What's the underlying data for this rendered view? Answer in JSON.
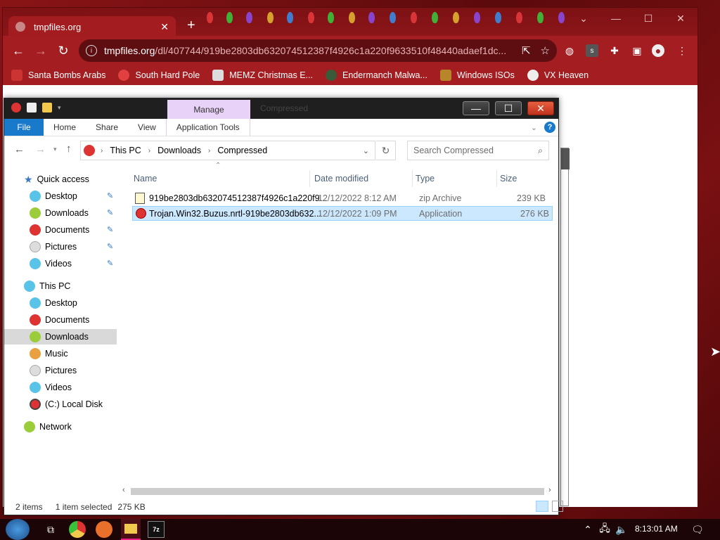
{
  "browser": {
    "tab_title": "tmpfiles.org",
    "url_host": "tmpfiles.org",
    "url_path": "/dl/407744/919be2803db632074512387f4926c1a220f9633510f48440adaef1dc...",
    "bookmarks": [
      {
        "label": "Santa Bombs Arabs",
        "icon": "santa-icon"
      },
      {
        "label": "South Hard Pole",
        "icon": "starburst-icon"
      },
      {
        "label": "MEMZ Christmas E...",
        "icon": "image-icon"
      },
      {
        "label": "Endermanch Malwa...",
        "icon": "ender-icon"
      },
      {
        "label": "Windows ISOs",
        "icon": "figure-icon"
      },
      {
        "label": "VX Heaven",
        "icon": "vx-icon"
      }
    ]
  },
  "explorer": {
    "manage_label": "Manage",
    "window_title": "Compressed",
    "ribbon_tabs": [
      "File",
      "Home",
      "Share",
      "View",
      "Application Tools"
    ],
    "breadcrumb": [
      "This PC",
      "Downloads",
      "Compressed"
    ],
    "search_placeholder": "Search Compressed",
    "nav": {
      "quick_access": "Quick access",
      "quick_items": [
        "Desktop",
        "Downloads",
        "Documents",
        "Pictures",
        "Videos"
      ],
      "this_pc": "This PC",
      "pc_items": [
        "Desktop",
        "Documents",
        "Downloads",
        "Music",
        "Pictures",
        "Videos",
        "(C:) Local Disk"
      ],
      "network": "Network"
    },
    "columns": [
      "Name",
      "Date modified",
      "Type",
      "Size"
    ],
    "files": [
      {
        "name": "919be2803db632074512387f4926c1a220f9...",
        "date": "12/12/2022 8:12 AM",
        "type": "zip Archive",
        "size": "239 KB"
      },
      {
        "name": "Trojan.Win32.Buzus.nrtl-919be2803db632...",
        "date": "12/12/2022 1:09 PM",
        "type": "Application",
        "size": "276 KB"
      }
    ],
    "status": {
      "count": "2 items",
      "selected": "1 item selected",
      "size": "275 KB"
    }
  },
  "taskbar": {
    "clock": "8:13:01 AM"
  },
  "colors": {
    "accent": "#1979ca",
    "selection": "#cce8ff",
    "browser_frame": "#a31d21",
    "manage_tab": "#e8d2f7"
  }
}
